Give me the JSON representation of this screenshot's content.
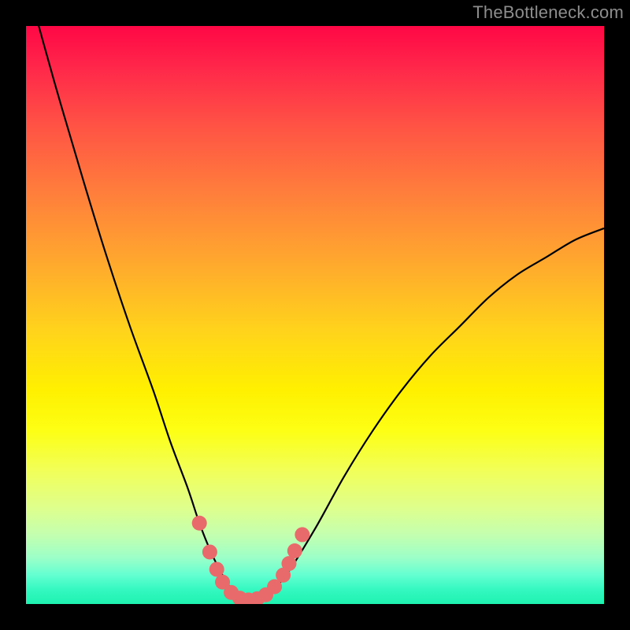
{
  "watermark": "TheBottleneck.com",
  "colors": {
    "frame": "#000000",
    "curve_stroke": "#000000",
    "marker_fill": "#e86a6a",
    "marker_stroke": "#c94f4f"
  },
  "chart_data": {
    "type": "line",
    "title": "",
    "xlabel": "",
    "ylabel": "",
    "xlim": [
      0,
      1
    ],
    "ylim": [
      0,
      100
    ],
    "series": [
      {
        "name": "bottleneck-curve",
        "x": [
          0.0,
          0.05,
          0.1,
          0.14,
          0.18,
          0.22,
          0.25,
          0.28,
          0.3,
          0.32,
          0.34,
          0.36,
          0.38,
          0.4,
          0.42,
          0.45,
          0.5,
          0.55,
          0.6,
          0.65,
          0.7,
          0.75,
          0.8,
          0.85,
          0.9,
          0.95,
          1.0
        ],
        "y": [
          108,
          90,
          73,
          60,
          48,
          37,
          28,
          20,
          14,
          9,
          5,
          2,
          1,
          1,
          2,
          5,
          13,
          22,
          30,
          37,
          43,
          48,
          53,
          57,
          60,
          63,
          65
        ]
      }
    ],
    "markers": [
      {
        "x": 0.3,
        "y": 14.0
      },
      {
        "x": 0.318,
        "y": 9.0
      },
      {
        "x": 0.33,
        "y": 6.0
      },
      {
        "x": 0.34,
        "y": 3.8
      },
      {
        "x": 0.355,
        "y": 2.0
      },
      {
        "x": 0.37,
        "y": 1.0
      },
      {
        "x": 0.385,
        "y": 0.7
      },
      {
        "x": 0.4,
        "y": 0.9
      },
      {
        "x": 0.415,
        "y": 1.6
      },
      {
        "x": 0.43,
        "y": 3.0
      },
      {
        "x": 0.445,
        "y": 5.0
      },
      {
        "x": 0.455,
        "y": 7.0
      },
      {
        "x": 0.465,
        "y": 9.2
      },
      {
        "x": 0.478,
        "y": 12.0
      }
    ],
    "marker_radius": 9.5
  }
}
